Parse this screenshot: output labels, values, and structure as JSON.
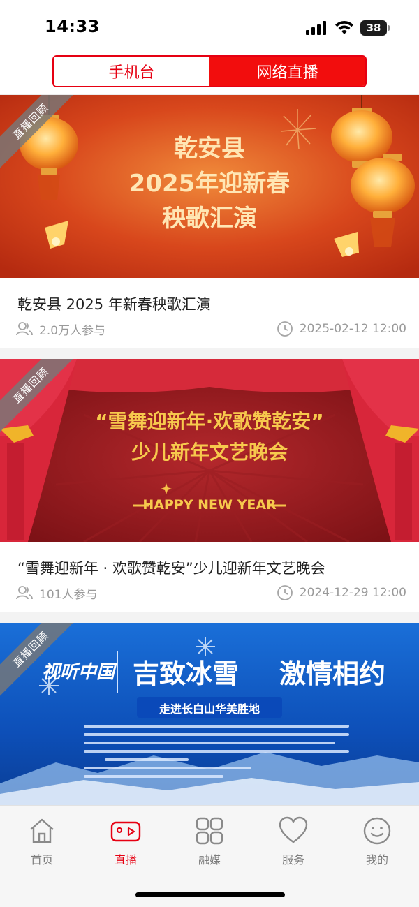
{
  "status_bar": {
    "time": "14:33",
    "battery": "38"
  },
  "segment_tabs": [
    {
      "label": "手机台",
      "active": false
    },
    {
      "label": "网络直播",
      "active": true
    }
  ],
  "ribbon_text": "直播回顾",
  "cards": [
    {
      "banner_lines": [
        "乾安县",
        "2025年迎新春",
        "秧歌汇演"
      ],
      "title": "乾安县 2025 年新春秧歌汇演",
      "participants": "2.0万人参与",
      "datetime": "2025-02-12 12:00"
    },
    {
      "banner_lines": [
        "“雪舞迎新年·欢歌赞乾安”",
        "少儿新年文艺晚会",
        "HAPPY NEW YEAR"
      ],
      "title": "“雪舞迎新年 · 欢歌赞乾安”少儿迎新年文艺晚会",
      "participants": "101人参与",
      "datetime": "2024-12-29 12:00"
    },
    {
      "banner_lines": [
        "视听中国",
        "吉致冰雪",
        "激情相约",
        "走进长白山华美胜地"
      ]
    }
  ],
  "tabbar": [
    {
      "label": "首页",
      "icon": "home-icon",
      "active": false
    },
    {
      "label": "直播",
      "icon": "video-camera-icon",
      "active": true
    },
    {
      "label": "融媒",
      "icon": "grid-icon",
      "active": false
    },
    {
      "label": "服务",
      "icon": "heart-icon",
      "active": false
    },
    {
      "label": "我的",
      "icon": "smiley-icon",
      "active": false
    }
  ],
  "colors": {
    "accent": "#e60012",
    "inactive_text": "#7c7c7c",
    "meta_text": "#9a9a9a"
  }
}
